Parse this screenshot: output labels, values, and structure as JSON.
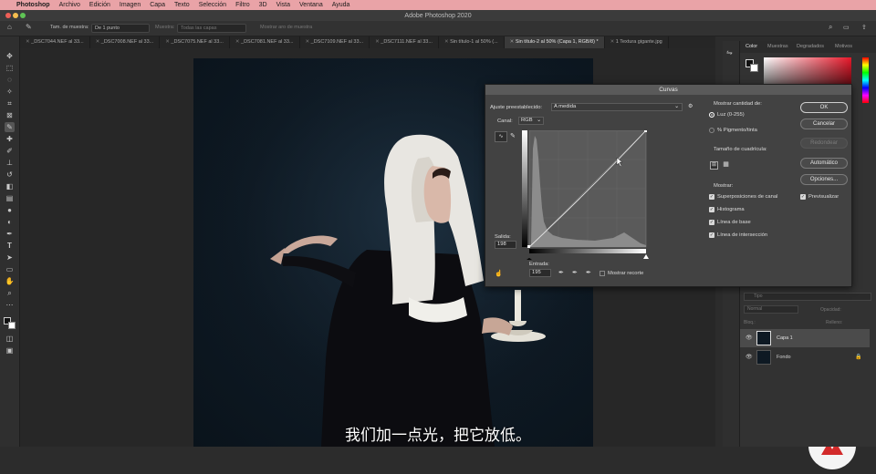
{
  "menubar": {
    "app": "Photoshop",
    "items": [
      "Archivo",
      "Edición",
      "Imagen",
      "Capa",
      "Texto",
      "Selección",
      "Filtro",
      "3D",
      "Vista",
      "Ventana",
      "Ayuda"
    ]
  },
  "window": {
    "title": "Adobe Photoshop 2020"
  },
  "options": {
    "sample_size_label": "Tam. de muestra:",
    "sample_size_value": "De 1 punto",
    "sample_label": "Muestra:",
    "sample_value": "Todas las capas",
    "show_ring": "Mostrar aro de muestra"
  },
  "tabs": [
    "_DSC7044.NEF al 33...",
    "_DSC7008.NEF al 33...",
    "_DSC7075.NEF al 33...",
    "_DSC7081.NEF al 33...",
    "_DSC7109.NEF al 33...",
    "_DSC7111.NEF al 33...",
    "Sin título-1 al 50% (...",
    "Sin título-2 al 50% (Capa 1, RGB/8) *",
    "1 Textura gigante.jpg"
  ],
  "active_tab_index": 7,
  "panels": {
    "color_tabs": [
      "Color",
      "Muestras",
      "Degradados",
      "Motivos"
    ],
    "layers": [
      {
        "name": "Capa 1",
        "selected": true
      },
      {
        "name": "Fondo",
        "selected": false,
        "locked": true
      }
    ],
    "search_placeholder": "Tipo",
    "blend_mode": "Normal",
    "opacity_label": "Opacidad:",
    "lock_label": "Bloq.:",
    "fill_label": "Relleno:"
  },
  "curves": {
    "title": "Curvas",
    "preset_label": "Ajuste preestablecido:",
    "preset_value": "A medida",
    "channel_label": "Canal:",
    "channel_value": "RGB",
    "output_label": "Salida:",
    "output_value": "198",
    "input_label": "Entrada:",
    "input_value": "195",
    "show_clipping": "Mostrar recorte",
    "amount_heading": "Mostrar cantidad de:",
    "light_option": "Luz (0-255)",
    "pigment_option": "% Pigmento/tinta",
    "grid_size_heading": "Tamaño de cuadrícula:",
    "show_heading": "Mostrar:",
    "show_options": [
      "Superposiciones de canal",
      "Histograma",
      "Línea de base",
      "Línea de intersección"
    ],
    "buttons": {
      "ok": "OK",
      "cancel": "Cancelar",
      "smooth": "Redondear",
      "auto": "Automático",
      "options": "Opciones..."
    },
    "preview": "Previsualizar",
    "colors": {
      "accent": "#5b8def"
    }
  },
  "subtitle": "我们加一点光，把它放低。"
}
